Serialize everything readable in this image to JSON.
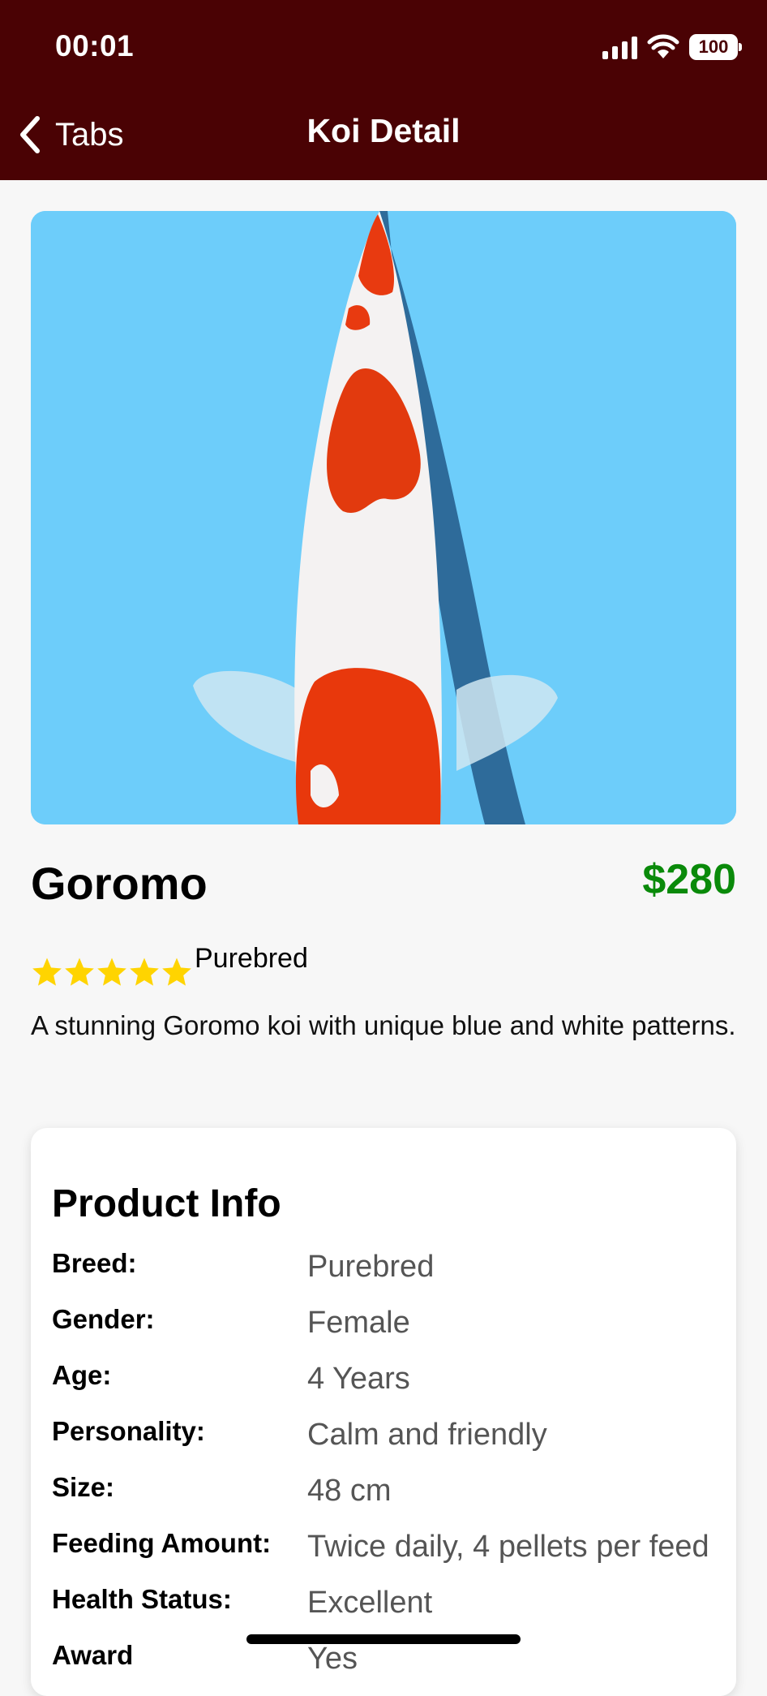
{
  "status_bar": {
    "time": "00:01",
    "battery": "100"
  },
  "nav": {
    "back_label": "Tabs",
    "title": "Koi Detail"
  },
  "koi": {
    "name": "Goromo",
    "price": "$280",
    "rating": 5,
    "rating_max": 5,
    "breed_tag": "Purebred",
    "description": "A stunning Goromo koi with unique blue and white patterns."
  },
  "product_info": {
    "title": "Product Info",
    "rows": [
      {
        "label": "Breed:",
        "value": "Purebred"
      },
      {
        "label": "Gender:",
        "value": "Female"
      },
      {
        "label": "Age:",
        "value": "4 Years"
      },
      {
        "label": "Personality:",
        "value": "Calm and friendly"
      },
      {
        "label": "Size:",
        "value": "48 cm"
      },
      {
        "label": "Feeding Amount:",
        "value": "Twice daily, 4 pellets per feed"
      },
      {
        "label": "Health Status:",
        "value": "Excellent"
      },
      {
        "label": "Award",
        "value": "Yes"
      }
    ]
  },
  "colors": {
    "header_bg": "#4a0204",
    "price": "#0a8a0a",
    "star": "#ffd400",
    "photo_bg": "#6dcdfa"
  },
  "icons": {
    "back": "chevron-left-icon",
    "signal": "cellular-signal-icon",
    "wifi": "wifi-icon",
    "battery": "battery-icon",
    "star": "star-icon"
  }
}
